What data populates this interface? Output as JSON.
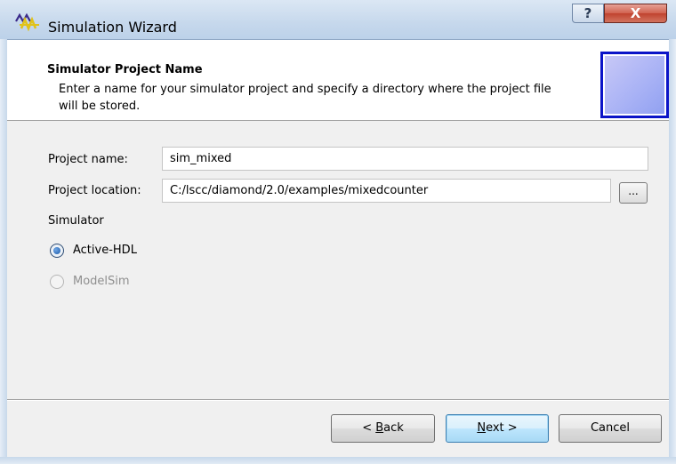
{
  "window": {
    "title": "Simulation Wizard",
    "help_glyph": "?",
    "close_glyph": "X"
  },
  "header": {
    "title": "Simulator Project Name",
    "description": "Enter a name for your simulator project and specify a directory where the project file will be stored."
  },
  "form": {
    "project_name_label": "Project name:",
    "project_name_value": "sim_mixed",
    "project_location_label": "Project location:",
    "project_location_value": "C:/lscc/diamond/2.0/examples/mixedcounter",
    "browse_label": "...",
    "simulator_label": "Simulator",
    "simulators": [
      {
        "label": "Active-HDL",
        "selected": true,
        "enabled": true
      },
      {
        "label": "ModelSim",
        "selected": false,
        "enabled": false
      }
    ]
  },
  "buttons": {
    "back_prefix": "< ",
    "back_mnemonic": "B",
    "back_rest": "ack",
    "next_mnemonic": "N",
    "next_rest": "ext >",
    "cancel": "Cancel"
  },
  "colors": {
    "title_bar": "#c6d8ec",
    "close_button": "#c0422e",
    "logo_border": "#0b14c8",
    "dialog_bg": "#f0f0f0",
    "default_button": "#bee6fd"
  }
}
